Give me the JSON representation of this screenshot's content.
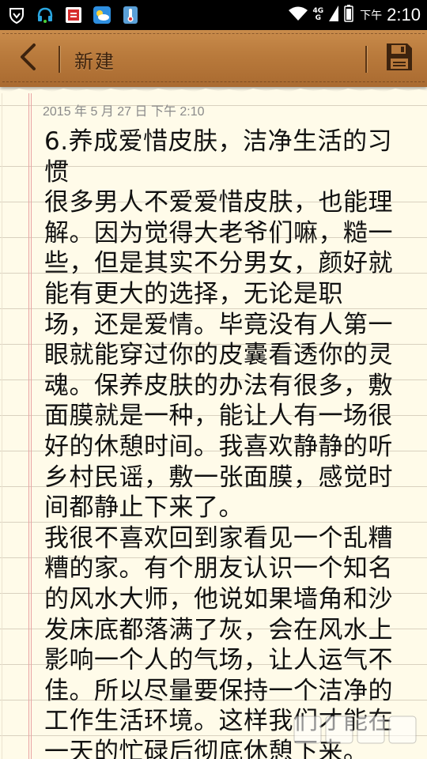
{
  "status_bar": {
    "icons": [
      "shield-icon",
      "headset-icon",
      "red-app-icon",
      "weather-icon",
      "thermometer-icon"
    ],
    "network_top": "4G",
    "network_bottom": "G",
    "ampm": "下午",
    "time": "2:10"
  },
  "toolbar": {
    "title": "新建",
    "back_icon": "chevron-left-icon",
    "save_icon": "floppy-disk-icon"
  },
  "note": {
    "date": "2015 年 5 月 27 日 下午 2:10",
    "lines": [
      "6.养成爱惜皮肤，洁净生活的习",
      "惯",
      "很多男人不爱爱惜皮肤，也能理",
      "解。因为觉得大老爷们嘛，糙一",
      "些，但是其实不分男女，颜好就",
      "能有更大的选择，无论是职",
      "场，还是爱情。毕竟没有人第一",
      "眼就能穿过你的皮囊看透你的灵",
      "魂。保养皮肤的办法有很多，敷",
      "面膜就是一种，能让人有一场很",
      "好的休憩时间。我喜欢静静的听",
      "乡村民谣，敷一张面膜，感觉时",
      "间都静止下来了。",
      "我很不喜欢回到家看见一个乱糟",
      "糟的家。有个朋友认识一个知名",
      "的风水大师，他说如果墙角和沙",
      "发床底都落满了灰，会在风水上",
      "影响一个人的气场，让人运气不",
      "佳。所以尽量要保持一个洁净的",
      "工作生活环境。这样我们才能在",
      "一天的忙碌后彻底休憩下来。"
    ]
  },
  "colors": {
    "leather": "#b97a3c",
    "paper": "#fffbe9",
    "margin_line": "#e8a3a3",
    "rule_line": "#d9d1bf"
  }
}
